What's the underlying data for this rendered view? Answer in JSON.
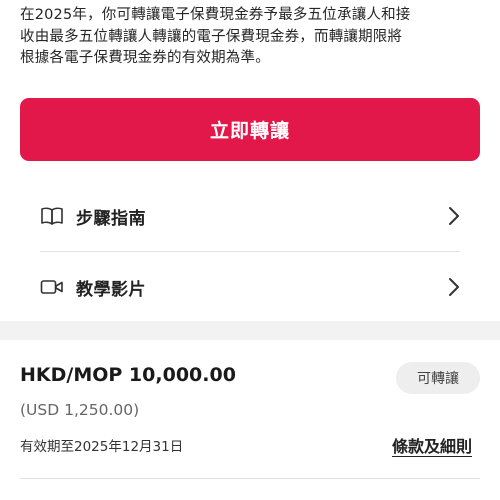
{
  "intro": {
    "line1": "在2025年，你可轉讓電子保費現金券予最多五位承讓人和接",
    "line2": "收由最多五位轉讓人轉讓的電子保費現金券，而轉讓期限將",
    "line3": "根據各電子保費現金券的有效期為準。"
  },
  "transfer_button": {
    "label": "立即轉讓",
    "color": "#e2184b"
  },
  "guide_rows": [
    {
      "label": "步驟指南",
      "icon": "book-icon"
    },
    {
      "label": "教學影片",
      "icon": "video-camera-icon"
    }
  ],
  "voucher": {
    "amount": "HKD/MOP 10,000.00",
    "badge": "可轉讓",
    "usd": "(USD 1,250.00)",
    "expiry": "有效期至2025年12月31日",
    "terms_link": "條款及細則"
  }
}
